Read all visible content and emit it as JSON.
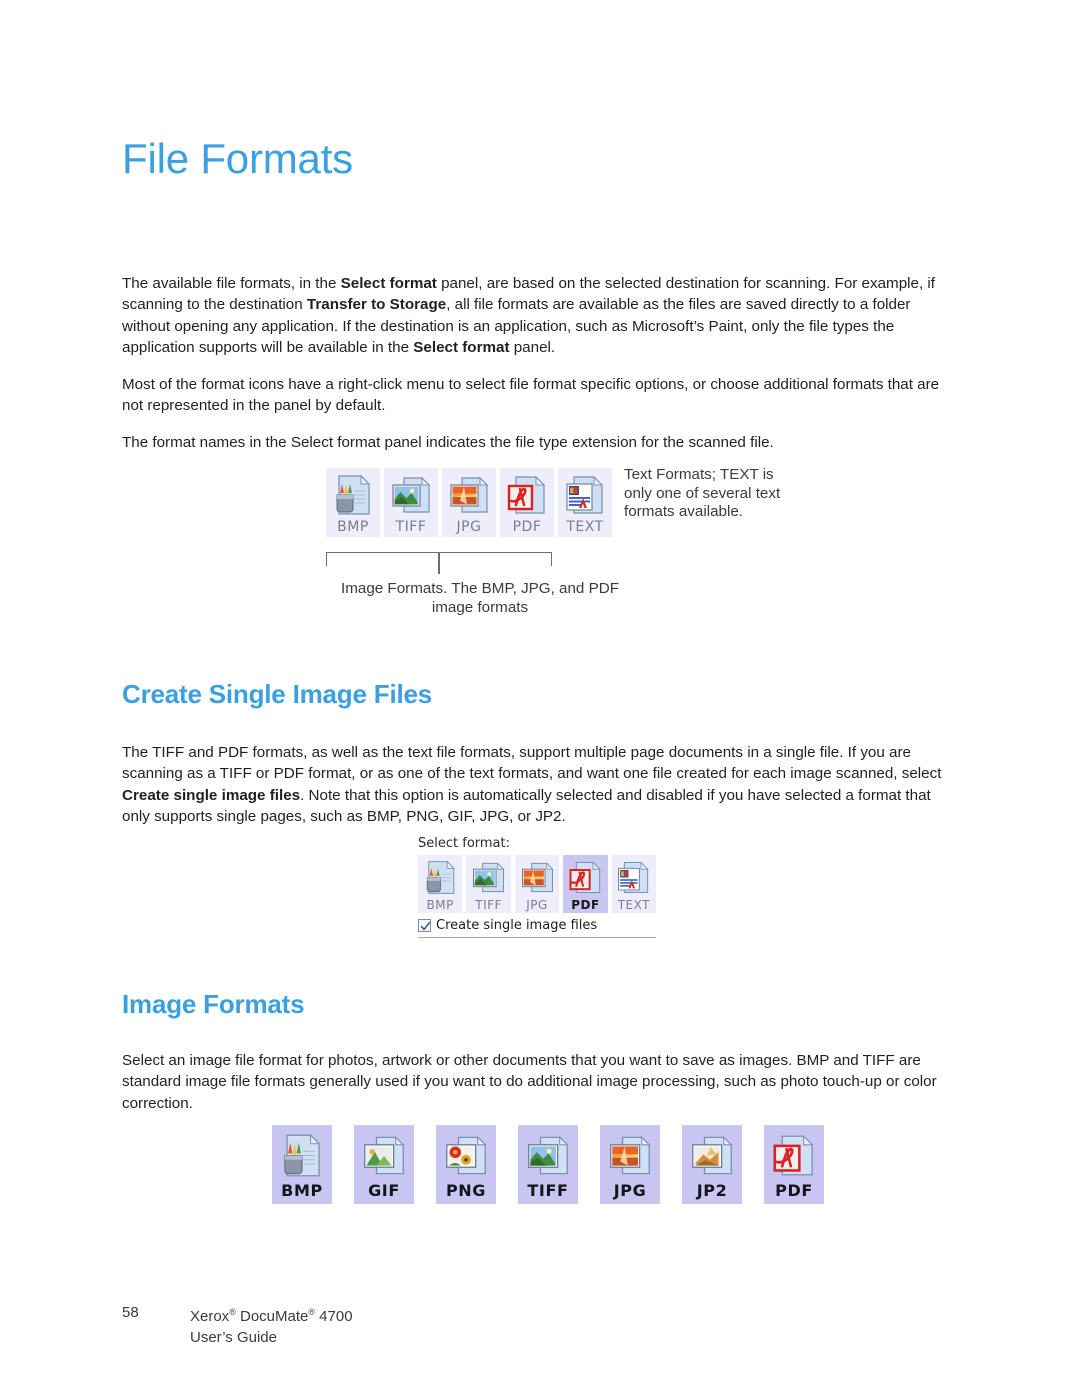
{
  "document": {
    "title": "File Formats"
  },
  "paragraphs": {
    "p1_part1": "The available file formats, in the ",
    "p1_bold1": "Select format",
    "p1_part2": " panel, are based on the selected destination for scanning. For example, if scanning to the destination ",
    "p1_bold2": "Transfer to Storage",
    "p1_part3": ", all file formats are available as the files are saved directly to a folder without opening any application. If the destination is an application, such as Microsoft’s Paint, only the file types the application supports will be available in the ",
    "p1_bold3": "Select format",
    "p1_part4": " panel.",
    "p2": "Most of the format icons have a right-click menu to select file format specific options, or choose additional formats that are not represented in the panel by default.",
    "p3": "The format names in the Select format panel indicates the file type extension for the scanned file.",
    "p4_part1": "The TIFF and PDF formats, as well as the text file formats, support multiple page documents in a single file. If you are scanning as a TIFF or PDF format, or as one of the text formats, and want one file created for each image scanned, select ",
    "p4_bold1": "Create single image files",
    "p4_part2": ". Note that this option is automatically selected and disabled if you have selected a format that only supports single pages, such as BMP, PNG, GIF, JPG, or JP2.",
    "p5": "Select an image file format for photos, artwork or other documents that you want to save as images. BMP and TIFF are standard image file formats generally used if you want to do additional image processing, such as photo touch-up or color correction."
  },
  "headings": {
    "create_single_image_files": "Create Single Image Files",
    "image_formats": "Image Formats"
  },
  "figure1": {
    "formats": [
      {
        "label": "BMP",
        "icon": "bmp-file-icon"
      },
      {
        "label": "TIFF",
        "icon": "tiff-file-icon"
      },
      {
        "label": "JPG",
        "icon": "jpg-file-icon"
      },
      {
        "label": "PDF",
        "icon": "pdf-file-icon"
      },
      {
        "label": "TEXT",
        "icon": "text-file-icon"
      }
    ],
    "callout_text_formats": "Text Formats; TEXT is only one of several text formats available.",
    "callout_image_formats": "Image Formats. The BMP, JPG, and PDF image formats"
  },
  "figure2": {
    "select_format_label": "Select format:",
    "formats": [
      {
        "label": "BMP",
        "icon": "bmp-file-icon",
        "selected": false
      },
      {
        "label": "TIFF",
        "icon": "tiff-file-icon",
        "selected": false
      },
      {
        "label": "JPG",
        "icon": "jpg-file-icon",
        "selected": false
      },
      {
        "label": "PDF",
        "icon": "pdf-file-icon",
        "selected": true
      },
      {
        "label": "TEXT",
        "icon": "text-file-icon",
        "selected": false
      }
    ],
    "checkbox_label": "Create single image files",
    "checkbox_checked": true
  },
  "figure3": {
    "formats": [
      {
        "label": "BMP",
        "icon": "bmp-file-icon"
      },
      {
        "label": "GIF",
        "icon": "gif-file-icon"
      },
      {
        "label": "PNG",
        "icon": "png-file-icon"
      },
      {
        "label": "TIFF",
        "icon": "tiff-file-icon"
      },
      {
        "label": "JPG",
        "icon": "jpg-file-icon"
      },
      {
        "label": "JP2",
        "icon": "jp2-file-icon"
      },
      {
        "label": "PDF",
        "icon": "pdf-file-icon"
      }
    ]
  },
  "footer": {
    "page_number": "58",
    "product_pre": "Xerox",
    "product_mid": " DocuMate",
    "product_post": " 4700",
    "registered_mark": "®",
    "guide": "User’s Guide"
  },
  "colors": {
    "heading_blue": "#3aa0e0",
    "body_text": "#231f20",
    "tile_bg_light": "#eeeefb",
    "tile_bg_strong": "#c8c5f2",
    "tile_bg_selected": "#c9c6f0",
    "pdf_red": "#e02020"
  }
}
